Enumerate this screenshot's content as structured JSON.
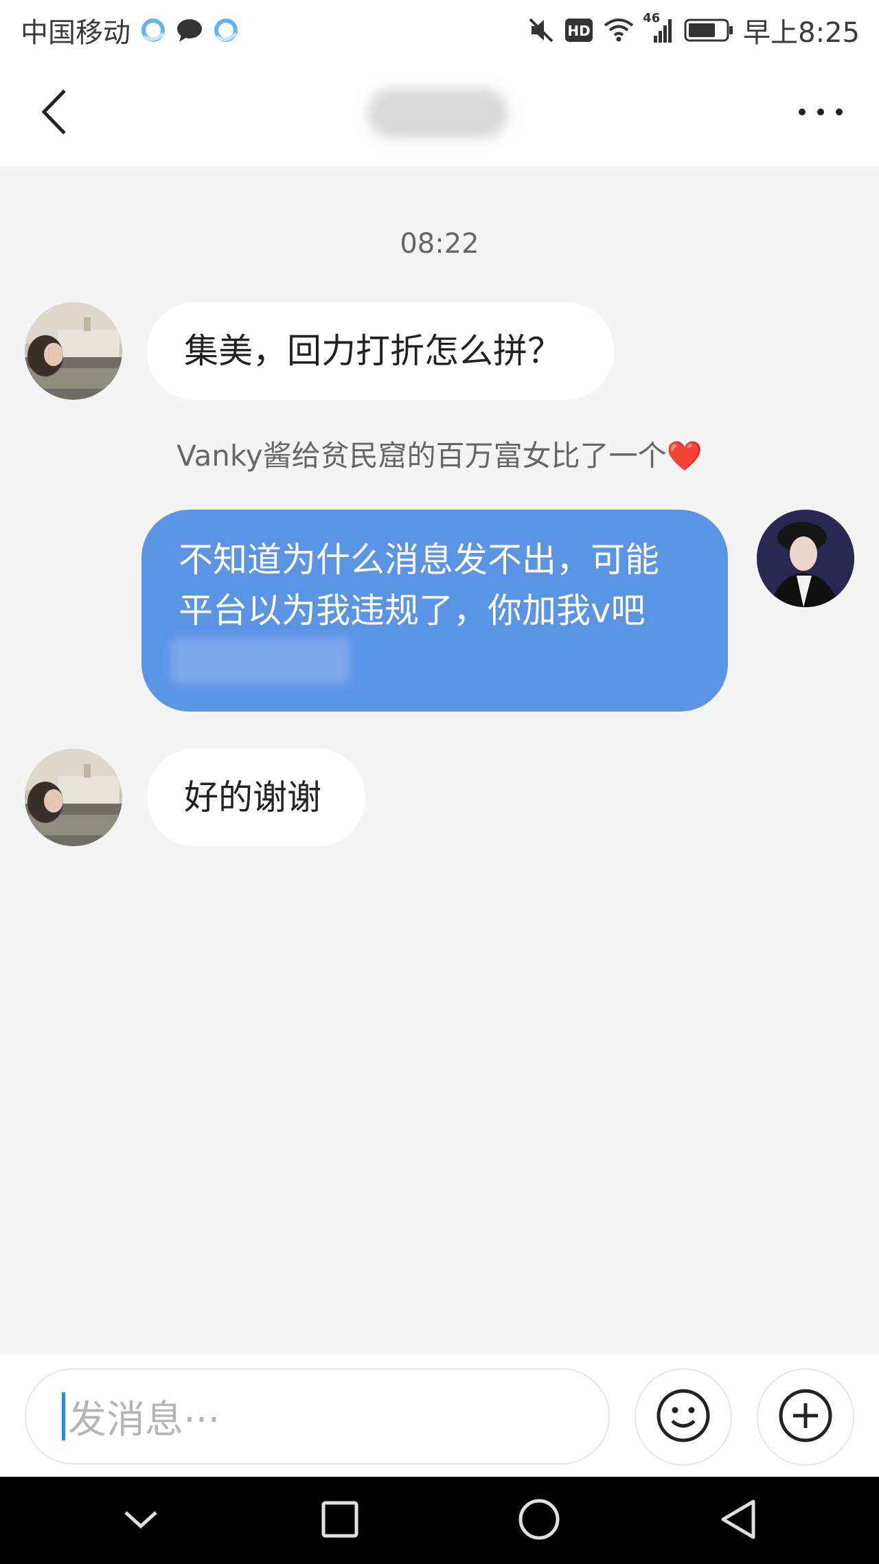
{
  "status_bar": {
    "carrier": "中国移动",
    "network": "46",
    "hd_badge": "HD",
    "time": "早上8:25",
    "left_icons": [
      "qq-browser-icon",
      "chat-bubble-icon",
      "qq-browser-icon"
    ],
    "right_icons": [
      "mute-icon",
      "hd-icon",
      "wifi-icon",
      "signal-icon",
      "battery-icon"
    ]
  },
  "header": {
    "title": "",
    "back_icon": "chevron-left-icon",
    "more_icon": "more-horizontal-icon"
  },
  "chat": {
    "timestamp": "08:22",
    "messages": [
      {
        "direction": "incoming",
        "text": "集美，回力打折怎么拼？"
      },
      {
        "direction": "outgoing",
        "line1": "不知道为什么消息发不出，可能",
        "line2": "平台以为我违规了，你加我v吧"
      },
      {
        "direction": "incoming",
        "text": "好的谢谢"
      }
    ],
    "notice": "Vanky酱给贫民窟的百万富女比了一个",
    "notice_emoji": "❤️"
  },
  "input_bar": {
    "placeholder": "发消息···",
    "emoji_icon": "smiley-icon",
    "plus_icon": "plus-circle-icon"
  },
  "colors": {
    "outgoing_bubble": "#5b93e5",
    "background": "#f4f4f5",
    "heart": "#e8232c",
    "caret": "#2e86e6"
  },
  "nav_bar": {
    "icons": [
      "chevron-down-icon",
      "square-icon",
      "circle-icon",
      "triangle-back-icon"
    ]
  }
}
